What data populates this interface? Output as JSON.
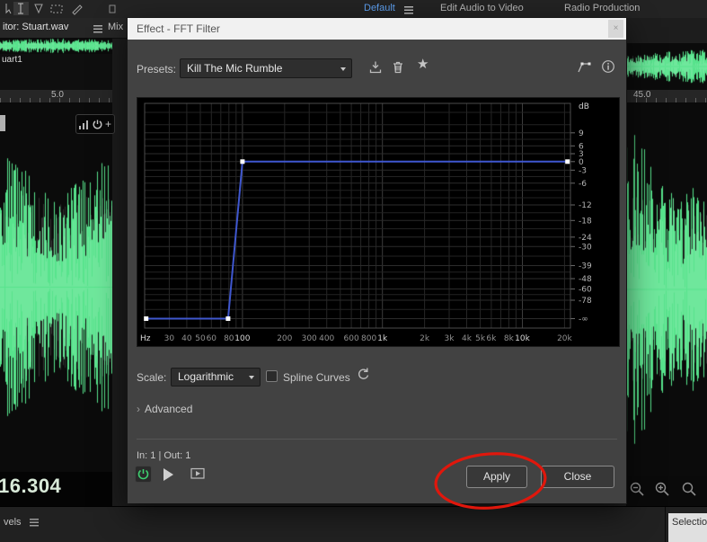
{
  "toolbar": {
    "workspace_tabs": [
      {
        "label": "Default",
        "active": true
      },
      {
        "label": "Edit Audio to Video",
        "active": false
      },
      {
        "label": "Radio Production",
        "active": false
      }
    ]
  },
  "editor": {
    "tab_label": "itor: Stuart.wav",
    "mix_tab_label": "Mix",
    "track_label": "uart1",
    "ruler_left": "5.0",
    "ruler_right": "45.0",
    "time_display": "16.304"
  },
  "panels": {
    "levels_label": "vels",
    "selection_label": "Selectio"
  },
  "dialog": {
    "title": "Effect - FFT Filter",
    "presets": {
      "label": "Presets:",
      "value": "Kill The Mic Rumble"
    },
    "scale": {
      "label": "Scale:",
      "value": "Logarithmic"
    },
    "spline_label": "Spline Curves",
    "advanced_label": "Advanced",
    "io_status": "In: 1 | Out: 1",
    "buttons": {
      "apply": "Apply",
      "close": "Close"
    }
  },
  "icons": {
    "star": "★",
    "close": "×",
    "info": "i",
    "advanced_chevron": "›",
    "plus": "+"
  },
  "colors": {
    "accent_green": "#57e38c",
    "annotation_red": "#e0170c",
    "curve_blue": "#3f57cf",
    "workspace_active": "#5ea0f0"
  },
  "chart_data": {
    "type": "line",
    "title": "FFT Filter frequency response",
    "x_axis": {
      "unit": "Hz",
      "scale": "log",
      "min": 20,
      "max": 22050,
      "major": [
        100,
        1000,
        10000
      ],
      "gridlines": [
        20,
        30,
        40,
        50,
        60,
        70,
        80,
        90,
        100,
        200,
        300,
        400,
        500,
        600,
        700,
        800,
        900,
        1000,
        2000,
        3000,
        4000,
        5000,
        6000,
        7000,
        8000,
        9000,
        10000,
        20000
      ],
      "labels": [
        {
          "f": 20,
          "t": "Hz",
          "emph": true
        },
        {
          "f": 30,
          "t": "30"
        },
        {
          "f": 40,
          "t": "40"
        },
        {
          "f": 50,
          "t": "50"
        },
        {
          "f": 60,
          "t": "60"
        },
        {
          "f": 80,
          "t": "80"
        },
        {
          "f": 100,
          "t": "100",
          "emph": true
        },
        {
          "f": 200,
          "t": "200"
        },
        {
          "f": 300,
          "t": "300"
        },
        {
          "f": 400,
          "t": "400"
        },
        {
          "f": 600,
          "t": "600"
        },
        {
          "f": 800,
          "t": "800"
        },
        {
          "f": 1000,
          "t": "1k",
          "emph": true
        },
        {
          "f": 2000,
          "t": "2k"
        },
        {
          "f": 3000,
          "t": "3k"
        },
        {
          "f": 4000,
          "t": "4k"
        },
        {
          "f": 5000,
          "t": "5k"
        },
        {
          "f": 6000,
          "t": "6k"
        },
        {
          "f": 8000,
          "t": "8k"
        },
        {
          "f": 10000,
          "t": "10k",
          "emph": true
        },
        {
          "f": 20000,
          "t": "20k"
        }
      ]
    },
    "y_axis": {
      "unit": "dB",
      "labels": [
        {
          "t": "9",
          "yp": 0.131
        },
        {
          "t": "6",
          "yp": 0.189
        },
        {
          "t": "3",
          "yp": 0.224
        },
        {
          "t": "0",
          "yp": 0.259
        },
        {
          "t": "-3",
          "yp": 0.297
        },
        {
          "t": "-6",
          "yp": 0.355
        },
        {
          "t": "-12",
          "yp": 0.452
        },
        {
          "t": "-18",
          "yp": 0.521
        },
        {
          "t": "-24",
          "yp": 0.595
        },
        {
          "t": "-30",
          "yp": 0.637
        },
        {
          "t": "-39",
          "yp": 0.722
        },
        {
          "t": "-48",
          "yp": 0.78
        },
        {
          "t": "-60",
          "yp": 0.826
        },
        {
          "t": "-78",
          "yp": 0.876
        },
        {
          "t": "-∞",
          "yp": 0.958
        }
      ],
      "minor_yp": [
        0.04,
        0.095,
        0.16,
        0.326,
        0.387,
        0.42,
        0.487,
        0.558,
        0.68,
        0.751,
        0.851,
        0.917
      ]
    },
    "curve": {
      "color": "#3f57cf",
      "points": [
        {
          "f": 20.5,
          "db": "-inf",
          "yp": 0.958
        },
        {
          "f": 79,
          "db": "-inf",
          "yp": 0.958
        },
        {
          "f": 100,
          "db": 0,
          "yp": 0.259
        },
        {
          "f": 21000,
          "db": 0,
          "yp": 0.259
        }
      ]
    }
  }
}
